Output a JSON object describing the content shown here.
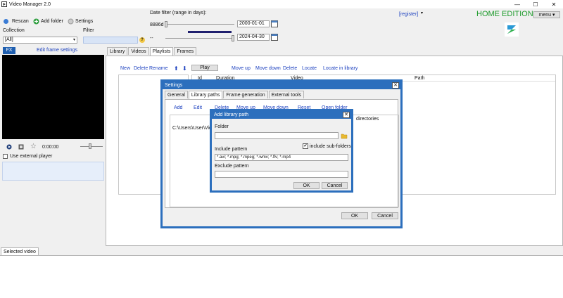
{
  "window": {
    "title": "Video Manager 2.0",
    "controls": [
      "—",
      "☐",
      "✕"
    ]
  },
  "toolbar": {
    "rescan": "Rescan",
    "add_folder": "Add folder",
    "settings": "Settings"
  },
  "collection": {
    "label": "Collection",
    "value": "[All]"
  },
  "filter": {
    "label": "Filter",
    "value": "",
    "help": "?"
  },
  "fx": {
    "button": "FX",
    "edit_frame_settings": "Edit frame settings"
  },
  "player": {
    "time": "0:00:00",
    "use_external_player": "Use external player"
  },
  "date_filter": {
    "label": "Date filter (range in days):",
    "days": "8886d",
    "start": "2000-01-01",
    "end": "2024-04-30",
    "end_prefix": "--"
  },
  "header": {
    "register": "[register]",
    "edition": "HOME EDITION",
    "menu": "menu ▾"
  },
  "main_tabs": [
    "Library",
    "Videos",
    "Playlists",
    "Frames"
  ],
  "playlist_toolbar": {
    "new": "New",
    "delete": "Delete",
    "rename": "Rename",
    "play": "Play",
    "move_up": "Move up",
    "move_down": "Move down",
    "delete2": "Delete",
    "locate": "Locate",
    "locate_in_library": "Locate in library"
  },
  "playlist_columns": [
    "Id",
    "Duration",
    "Video",
    "Path"
  ],
  "bottom": {
    "tab": "Selected video"
  },
  "settings_dialog": {
    "title": "Settings",
    "tabs": [
      "General",
      "Library paths",
      "Frame generation",
      "External tools"
    ],
    "actions": [
      "Add",
      "Edit",
      "Delete",
      "Move up",
      "Move down",
      "Reset",
      "Open folder"
    ],
    "paths": [
      "C:\\Users\\User\\Videos"
    ],
    "column_right": "directories",
    "ok": "OK",
    "cancel": "Cancel"
  },
  "add_path_dialog": {
    "title": "Add library path",
    "folder_label": "Folder",
    "folder_value": "",
    "include_subfolders": "include sub-folders",
    "include_pattern_label": "Include pattern",
    "include_pattern_value": "*.avi; *.mpg; *.mpeg; *.wmv; *.flv; *.mp4",
    "exclude_pattern_label": "Exclude pattern",
    "exclude_pattern_value": "",
    "ok": "OK",
    "cancel": "Cancel"
  },
  "colors": {
    "accent": "#2c6fbd",
    "edition_green": "#1c9a2a",
    "link": "#1a3fbf",
    "slider_bar": "#1f1f6e"
  }
}
